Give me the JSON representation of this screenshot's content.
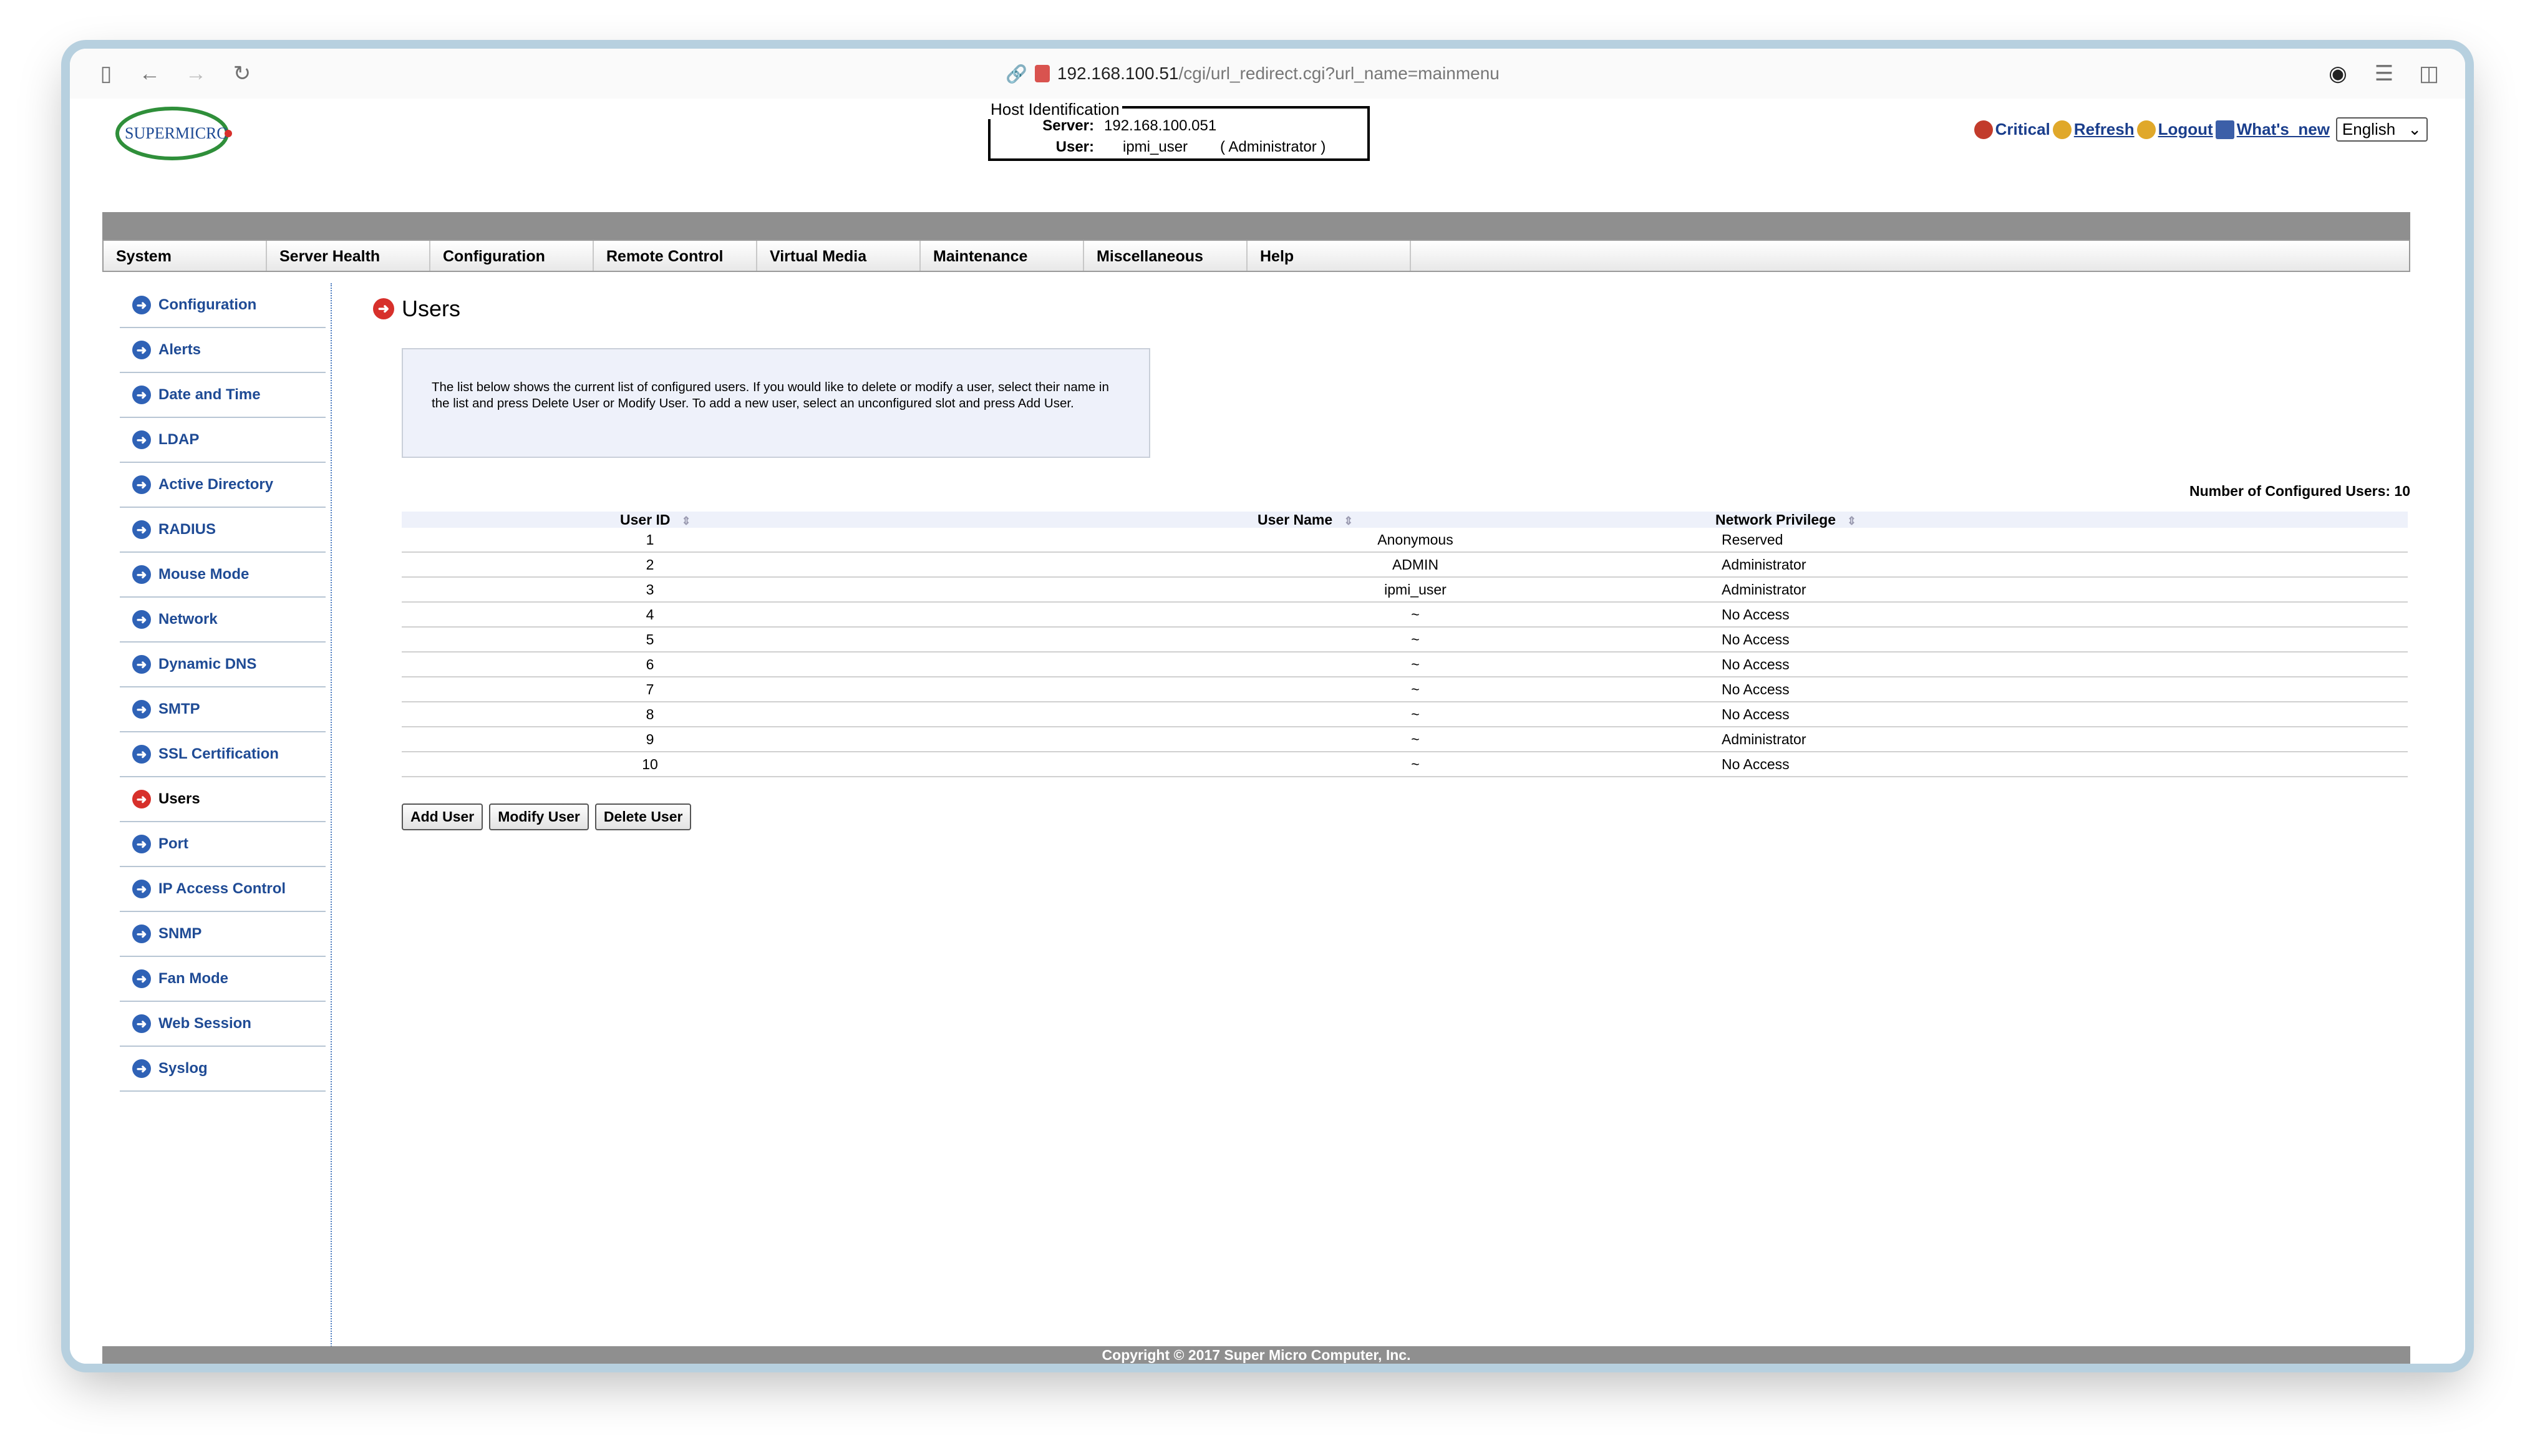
{
  "browser": {
    "url_host": "192.168.100.51",
    "url_path": "/cgi/url_redirect.cgi?url_name=mainmenu"
  },
  "header": {
    "logo_text": "SUPERMICRO",
    "host_identification": {
      "legend": "Host Identification",
      "server_label": "Server:",
      "server_value": "192.168.100.051",
      "user_label": "User:",
      "user_value": "ipmi_user",
      "user_role": "( Administrator )"
    },
    "links": {
      "critical": "Critical",
      "refresh": "Refresh",
      "logout": "Logout",
      "whats_new": "What's_new"
    },
    "language": "English"
  },
  "menu": [
    "System",
    "Server Health",
    "Configuration",
    "Remote Control",
    "Virtual Media",
    "Maintenance",
    "Miscellaneous",
    "Help"
  ],
  "sidebar": {
    "items": [
      {
        "label": "Configuration"
      },
      {
        "label": "Alerts"
      },
      {
        "label": "Date and Time"
      },
      {
        "label": "LDAP"
      },
      {
        "label": "Active Directory"
      },
      {
        "label": "RADIUS"
      },
      {
        "label": "Mouse Mode"
      },
      {
        "label": "Network"
      },
      {
        "label": "Dynamic DNS"
      },
      {
        "label": "SMTP"
      },
      {
        "label": "SSL Certification"
      },
      {
        "label": "Users",
        "active": true
      },
      {
        "label": "Port"
      },
      {
        "label": "IP Access Control"
      },
      {
        "label": "SNMP"
      },
      {
        "label": "Fan Mode"
      },
      {
        "label": "Web Session"
      },
      {
        "label": "Syslog"
      }
    ]
  },
  "main": {
    "title": "Users",
    "info": "The list below shows the current list of configured users. If you would like to delete or modify a user, select their name in the list and press Delete User or Modify User. To add a new user, select an unconfigured slot and press Add User.",
    "count_text": "Number of Configured Users: 10",
    "columns": [
      "User ID",
      "User Name",
      "Network Privilege"
    ],
    "rows": [
      {
        "id": "1",
        "name": "Anonymous",
        "privilege": "Reserved"
      },
      {
        "id": "2",
        "name": "ADMIN",
        "privilege": "Administrator"
      },
      {
        "id": "3",
        "name": "ipmi_user",
        "privilege": "Administrator"
      },
      {
        "id": "4",
        "name": "~",
        "privilege": "No Access"
      },
      {
        "id": "5",
        "name": "~",
        "privilege": "No Access"
      },
      {
        "id": "6",
        "name": "~",
        "privilege": "No Access"
      },
      {
        "id": "7",
        "name": "~",
        "privilege": "No Access"
      },
      {
        "id": "8",
        "name": "~",
        "privilege": "No Access"
      },
      {
        "id": "9",
        "name": "~",
        "privilege": "Administrator"
      },
      {
        "id": "10",
        "name": "~",
        "privilege": "No Access"
      }
    ],
    "buttons": {
      "add": "Add User",
      "modify": "Modify User",
      "delete": "Delete User"
    }
  },
  "footer": "Copyright © 2017 Super Micro Computer, Inc."
}
